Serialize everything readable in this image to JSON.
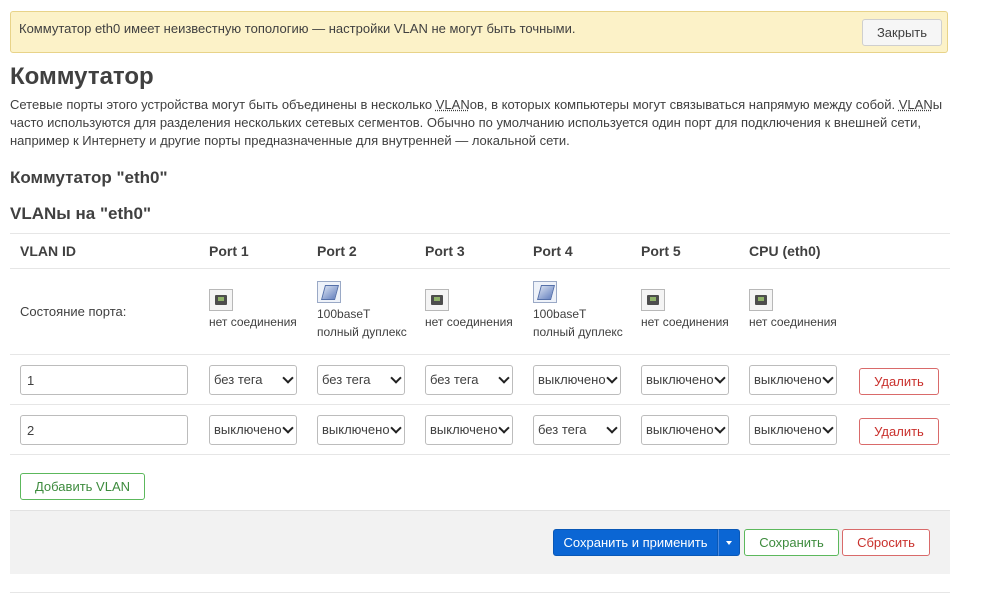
{
  "alert": {
    "text": "Коммутатор eth0 имеет неизвестную топологию — настройки VLAN не могут быть точными.",
    "close_label": "Закрыть"
  },
  "page": {
    "title": "Коммутатор",
    "desc_1": "Сетевые порты этого устройства могут быть объединены в несколько ",
    "desc_abbr_1": "VLAN",
    "desc_2": "ов, в которых компьютеры могут связываться напрямую между собой. ",
    "desc_abbr_2": "VLAN",
    "desc_3": "ы часто используются для разделения нескольких сетевых сегментов. Обычно по умолчанию используется один порт для подключения к внешней сети, например к Интернету и другие порты предназначенные для внутренней — локальной сети.",
    "switch_heading": "Коммутатор \"eth0\"",
    "vlans_heading": "VLANы на \"eth0\""
  },
  "table": {
    "headers": [
      "VLAN ID",
      "Port 1",
      "Port 2",
      "Port 3",
      "Port 4",
      "Port 5",
      "CPU (eth0)"
    ],
    "status_label": "Состояние порта:",
    "ports": [
      {
        "state": "down",
        "line1": "нет соединения",
        "line2": "",
        "icon": "ethernet-port-icon"
      },
      {
        "state": "up",
        "line1": "100baseT",
        "line2": "полный дуплекс",
        "icon": "ethernet-plugged-icon"
      },
      {
        "state": "down",
        "line1": "нет соединения",
        "line2": "",
        "icon": "ethernet-port-icon"
      },
      {
        "state": "up",
        "line1": "100baseT",
        "line2": "полный дуплекс",
        "icon": "ethernet-plugged-icon"
      },
      {
        "state": "down",
        "line1": "нет соединения",
        "line2": "",
        "icon": "ethernet-port-icon"
      },
      {
        "state": "down",
        "line1": "нет соединения",
        "line2": "",
        "icon": "ethernet-port-icon"
      }
    ],
    "rows": [
      {
        "vid": "1",
        "values": [
          "без тега",
          "без тега",
          "без тега",
          "выключено",
          "выключено",
          "выключено"
        ],
        "delete_label": "Удалить"
      },
      {
        "vid": "2",
        "values": [
          "выключено",
          "выключено",
          "выключено",
          "без тега",
          "выключено",
          "выключено"
        ],
        "delete_label": "Удалить"
      }
    ],
    "add_label": "Добавить VLAN"
  },
  "footer": {
    "save_apply_label": "Сохранить и применить",
    "save_label": "Сохранить",
    "reset_label": "Сбросить"
  },
  "colors": {
    "primary": "#0b66d4",
    "positive": "#5cb85c",
    "negative": "#d96a6a",
    "alert_bg": "#fcf2c8"
  }
}
